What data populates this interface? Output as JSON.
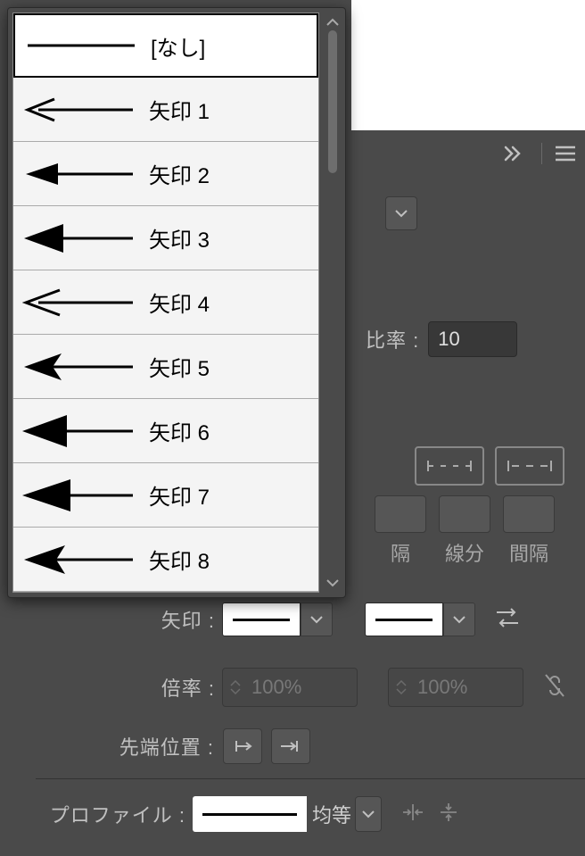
{
  "colors": {
    "panel_bg": "#4a4a4a",
    "text": "#d0d0d0",
    "muted": "#888"
  },
  "arrowhead_dropdown": {
    "selected_index": 0,
    "items": [
      {
        "label": "[なし]",
        "type": "none"
      },
      {
        "label": "矢印 1",
        "type": "arrow1"
      },
      {
        "label": "矢印 2",
        "type": "arrow2"
      },
      {
        "label": "矢印 3",
        "type": "arrow3"
      },
      {
        "label": "矢印 4",
        "type": "arrow4"
      },
      {
        "label": "矢印 5",
        "type": "arrow5"
      },
      {
        "label": "矢印 6",
        "type": "arrow6"
      },
      {
        "label": "矢印 7",
        "type": "arrow7"
      },
      {
        "label": "矢印 8",
        "type": "arrow8"
      }
    ]
  },
  "panel": {
    "ratio_label": "比率 :",
    "ratio_value": "10",
    "segment_labels": [
      "隔",
      "線分",
      "間隔"
    ],
    "arrow_label": "矢印 :",
    "scale_label": "倍率 :",
    "scale_start_value": "100%",
    "scale_end_value": "100%",
    "tip_label": "先端位置 :",
    "profile_label": "プロファイル :",
    "profile_value": "均等"
  },
  "icons": {
    "expand": ">>",
    "menu": "≡"
  }
}
